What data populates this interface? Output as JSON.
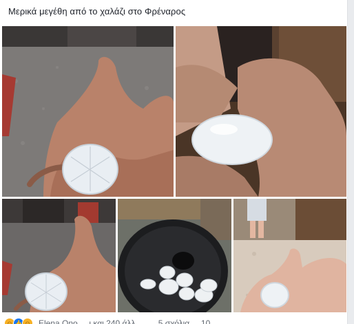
{
  "post": {
    "caption": "Μερικά μεγέθη από το χαλάζι στο Φρέναρος",
    "photos": [
      {
        "name": "hailstone-in-palm-1"
      },
      {
        "name": "hailstone-held-fingers"
      },
      {
        "name": "hailstone-in-palm-2"
      },
      {
        "name": "hailstones-on-lid"
      },
      {
        "name": "hailstone-in-hand-floor"
      }
    ]
  },
  "footer": {
    "reactions": [
      "haha-icon",
      "like-icon",
      "wow-icon"
    ],
    "reaction_text": "Elena Ono ... ι και 240 άλλ... . . . 5 σχόλια ... 10 ..."
  },
  "colors": {
    "background": "#e9ebee",
    "card": "#ffffff",
    "text": "#1d2129",
    "like_blue": "#1877f2"
  }
}
